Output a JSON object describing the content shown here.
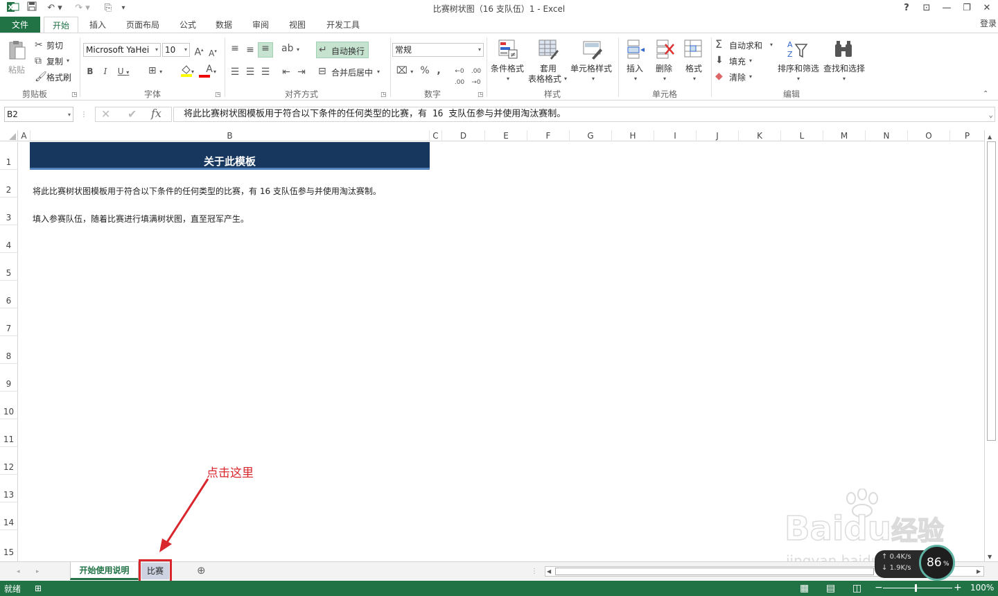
{
  "window": {
    "title": "比赛树状图（16 支队伍）1 - Excel",
    "help": "?",
    "controls": [
      "⊡",
      "—",
      "❐",
      "✕"
    ]
  },
  "tabs": {
    "file": "文件",
    "items": [
      "开始",
      "插入",
      "页面布局",
      "公式",
      "数据",
      "审阅",
      "视图",
      "开发工具"
    ],
    "login": "登录"
  },
  "ribbon": {
    "clipboard": {
      "label": "剪贴板",
      "paste": "粘贴",
      "cut": "剪切",
      "copy": "复制",
      "format_painter": "格式刷"
    },
    "font": {
      "label": "字体",
      "name": "Microsoft YaHei",
      "size": "10"
    },
    "alignment": {
      "label": "对齐方式",
      "wrap": "自动换行",
      "merge": "合并后居中"
    },
    "number": {
      "label": "数字",
      "format": "常规"
    },
    "styles": {
      "label": "样式",
      "conditional": "条件格式",
      "table1": "套用",
      "table2": "表格格式",
      "cell_styles": "单元格样式"
    },
    "cells": {
      "label": "单元格",
      "insert": "插入",
      "delete": "删除",
      "format": "格式"
    },
    "editing": {
      "label": "编辑",
      "autosum": "自动求和",
      "fill": "填充",
      "clear": "清除",
      "sort": "排序和筛选",
      "find": "查找和选择"
    }
  },
  "formula_bar": {
    "name_box": "B2",
    "fx": "fx",
    "content": "将此比赛树状图模板用于符合以下条件的任何类型的比赛，有 16 支队伍参与并使用淘汰赛制。"
  },
  "grid": {
    "columns": [
      "A",
      "B",
      "C",
      "D",
      "E",
      "F",
      "G",
      "H",
      "I",
      "J",
      "K",
      "L",
      "M",
      "N",
      "O",
      "P"
    ],
    "rows": [
      "1",
      "2",
      "3",
      "4",
      "5",
      "6",
      "7",
      "8",
      "9",
      "10",
      "11",
      "12",
      "13",
      "14",
      "15"
    ],
    "header_title": "关于此模板",
    "line1": "将此比赛树状图模板用于符合以下条件的任何类型的比赛，有 16 支队伍参与并使用淘汰赛制。",
    "line2": "填入参赛队伍，随着比赛进行填满树状图，直至冠军产生。",
    "header_color": "#17375e"
  },
  "annotation": {
    "text": "点击这里",
    "color": "#d9262c"
  },
  "sheet_tabs": [
    "开始使用说明",
    "比赛"
  ],
  "status": {
    "ready": "就绪",
    "zoom": "100%"
  },
  "net_widget": {
    "up": "0.4K/s",
    "down": "1.9K/s",
    "pct": "86",
    "unit": "%"
  },
  "watermark": {
    "brand": "Bai",
    "brand2": "du",
    "cn": "经验",
    "url": "jingyan.baidu.com"
  }
}
